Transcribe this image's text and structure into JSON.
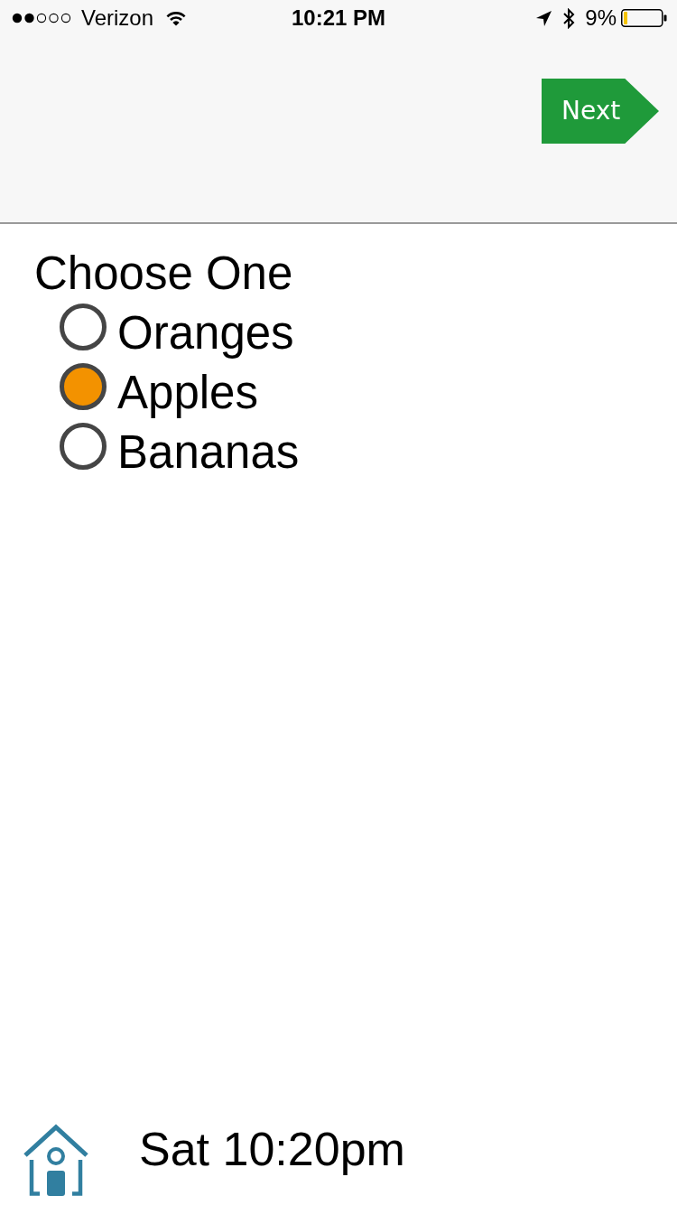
{
  "status_bar": {
    "carrier": "Verizon",
    "time": "10:21 PM",
    "battery_percent": "9%"
  },
  "header": {
    "next_button": "Next"
  },
  "question": {
    "title": "Choose One",
    "options": [
      {
        "label": "Oranges",
        "selected": false
      },
      {
        "label": "Apples",
        "selected": true
      },
      {
        "label": "Bananas",
        "selected": false
      }
    ]
  },
  "footer": {
    "timestamp": "Sat 10:20pm"
  }
}
